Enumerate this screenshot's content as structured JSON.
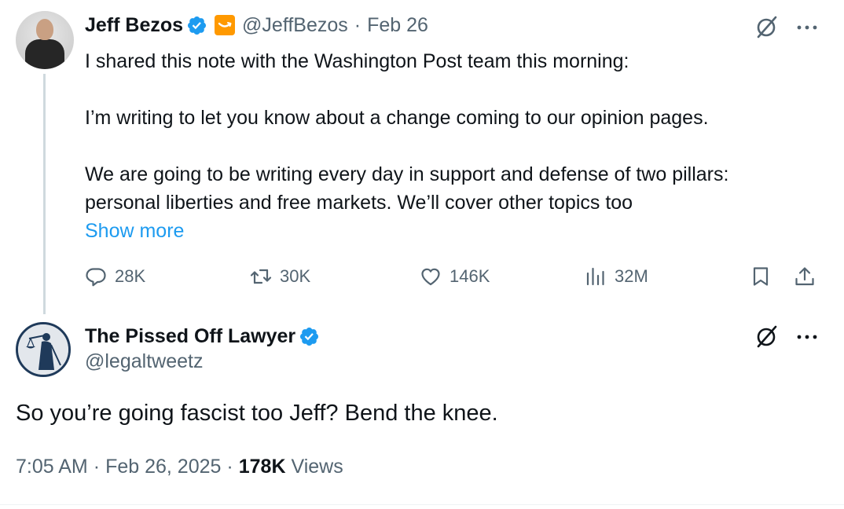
{
  "parent_tweet": {
    "author_name": "Jeff Bezos",
    "handle": "@JeffBezos",
    "date": "Feb 26",
    "separator": "·",
    "text_lines": [
      "I shared this note with the Washington Post team this morning:",
      "",
      "I’m writing to let you know about a change coming to our opinion pages.",
      "",
      "We are going to be writing every day in support and defense of two pillars:",
      "personal liberties and free markets. We’ll cover other topics too"
    ],
    "show_more_label": "Show more",
    "metrics": {
      "replies": "28K",
      "reposts": "30K",
      "likes": "146K",
      "views": "32M"
    }
  },
  "reply_tweet": {
    "author_name": "The Pissed Off Lawyer",
    "handle": "@legaltweetz",
    "text": "So you’re going fascist too Jeff? Bend the knee.",
    "time": "7:05 AM",
    "date": "Feb 26, 2025",
    "separator": "·",
    "views_count": "178K",
    "views_label": "Views"
  },
  "colors": {
    "verified": "#1d9bf0",
    "link": "#1d9bf0",
    "secondary_text": "#536471",
    "primary_text": "#0f1419",
    "affiliate_badge": "#ff9900"
  },
  "icons": {
    "reply": "reply-icon",
    "repost": "repost-icon",
    "like": "like-icon",
    "views": "views-icon",
    "bookmark": "bookmark-icon",
    "share": "share-icon",
    "grok": "grok-icon",
    "more": "more-icon"
  }
}
